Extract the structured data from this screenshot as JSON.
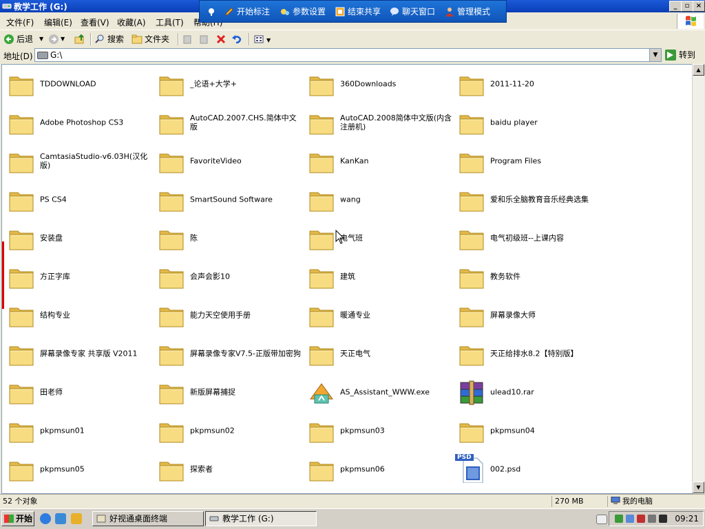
{
  "window": {
    "title": "教学工作 (G:)"
  },
  "caption_buttons": [
    "_",
    "▫",
    "×"
  ],
  "share_toolbar": {
    "items": [
      {
        "label": "开始标注",
        "icon": "pen-icon"
      },
      {
        "label": "参数设置",
        "icon": "settings-icon"
      },
      {
        "label": "结束共享",
        "icon": "stop-share-icon"
      },
      {
        "label": "聊天窗口",
        "icon": "chat-icon"
      },
      {
        "label": "管理模式",
        "icon": "admin-icon"
      }
    ]
  },
  "menu": {
    "items": [
      "文件(F)",
      "编辑(E)",
      "查看(V)",
      "收藏(A)",
      "工具(T)",
      "帮助(H)"
    ]
  },
  "toolbar": {
    "back_label": "后退",
    "search_label": "搜索",
    "folders_label": "文件夹"
  },
  "address": {
    "label": "地址(D)",
    "value": "G:\\",
    "go_label": "转到"
  },
  "files": [
    {
      "name": "TDDOWNLOAD",
      "type": "folder"
    },
    {
      "name": "_论语+大学+",
      "type": "folder"
    },
    {
      "name": "360Downloads",
      "type": "folder"
    },
    {
      "name": "2011-11-20",
      "type": "folder"
    },
    {
      "name": "Adobe Photoshop CS3",
      "type": "folder"
    },
    {
      "name": "AutoCAD.2007.CHS.简体中文版",
      "type": "folder"
    },
    {
      "name": "AutoCAD.2008简体中文版(内含注册机)",
      "type": "folder"
    },
    {
      "name": "baidu player",
      "type": "folder"
    },
    {
      "name": "CamtasiaStudio-v6.03H(汉化版)",
      "type": "folder"
    },
    {
      "name": "FavoriteVideo",
      "type": "folder"
    },
    {
      "name": "KanKan",
      "type": "folder"
    },
    {
      "name": "Program Files",
      "type": "folder"
    },
    {
      "name": "PS CS4",
      "type": "folder"
    },
    {
      "name": "SmartSound Software",
      "type": "folder"
    },
    {
      "name": "wang",
      "type": "folder"
    },
    {
      "name": "爱和乐全脑教育音乐经典选集",
      "type": "folder"
    },
    {
      "name": "安装盘",
      "type": "folder"
    },
    {
      "name": "陈",
      "type": "folder"
    },
    {
      "name": "电气班",
      "type": "folder"
    },
    {
      "name": "电气初级班--上课内容",
      "type": "folder"
    },
    {
      "name": "方正字库",
      "type": "folder"
    },
    {
      "name": "会声会影10",
      "type": "folder"
    },
    {
      "name": "建筑",
      "type": "folder"
    },
    {
      "name": "教务软件",
      "type": "folder"
    },
    {
      "name": "结构专业",
      "type": "folder"
    },
    {
      "name": "能力天空使用手册",
      "type": "folder"
    },
    {
      "name": "暖通专业",
      "type": "folder"
    },
    {
      "name": "屏幕录像大师",
      "type": "folder"
    },
    {
      "name": "屏幕录像专家 共享版 V2011",
      "type": "folder"
    },
    {
      "name": "屏幕录像专家V7.5-正版带加密狗",
      "type": "folder"
    },
    {
      "name": "天正电气",
      "type": "folder"
    },
    {
      "name": "天正给排水8.2【特别版】",
      "type": "folder"
    },
    {
      "name": "田老师",
      "type": "folder"
    },
    {
      "name": "新版屏幕捕捉",
      "type": "folder"
    },
    {
      "name": "AS_Assistant_WWW.exe",
      "type": "exe"
    },
    {
      "name": "ulead10.rar",
      "type": "rar"
    },
    {
      "name": "pkpmsun01",
      "type": "folder"
    },
    {
      "name": "pkpmsun02",
      "type": "folder"
    },
    {
      "name": "pkpmsun03",
      "type": "folder"
    },
    {
      "name": "pkpmsun04",
      "type": "folder"
    },
    {
      "name": "pkpmsun05",
      "type": "folder"
    },
    {
      "name": "探索者",
      "type": "folder"
    },
    {
      "name": "pkpmsun06",
      "type": "folder"
    },
    {
      "name": "002.psd",
      "type": "psd"
    }
  ],
  "psd_badge": "PSD",
  "status": {
    "objects": "52 个对象",
    "size": "270 MB",
    "location": "我的电脑"
  },
  "taskbar": {
    "start_label": "开始",
    "tasks": [
      "好视通桌面终端",
      "教学工作 (G:)"
    ],
    "clock": "09:21"
  },
  "colors": {
    "titlebar": "#0a3fb7",
    "share_toolbar": "#1565c8",
    "folder_yellow": "#f5d77a",
    "selection_red": "#e00000"
  }
}
